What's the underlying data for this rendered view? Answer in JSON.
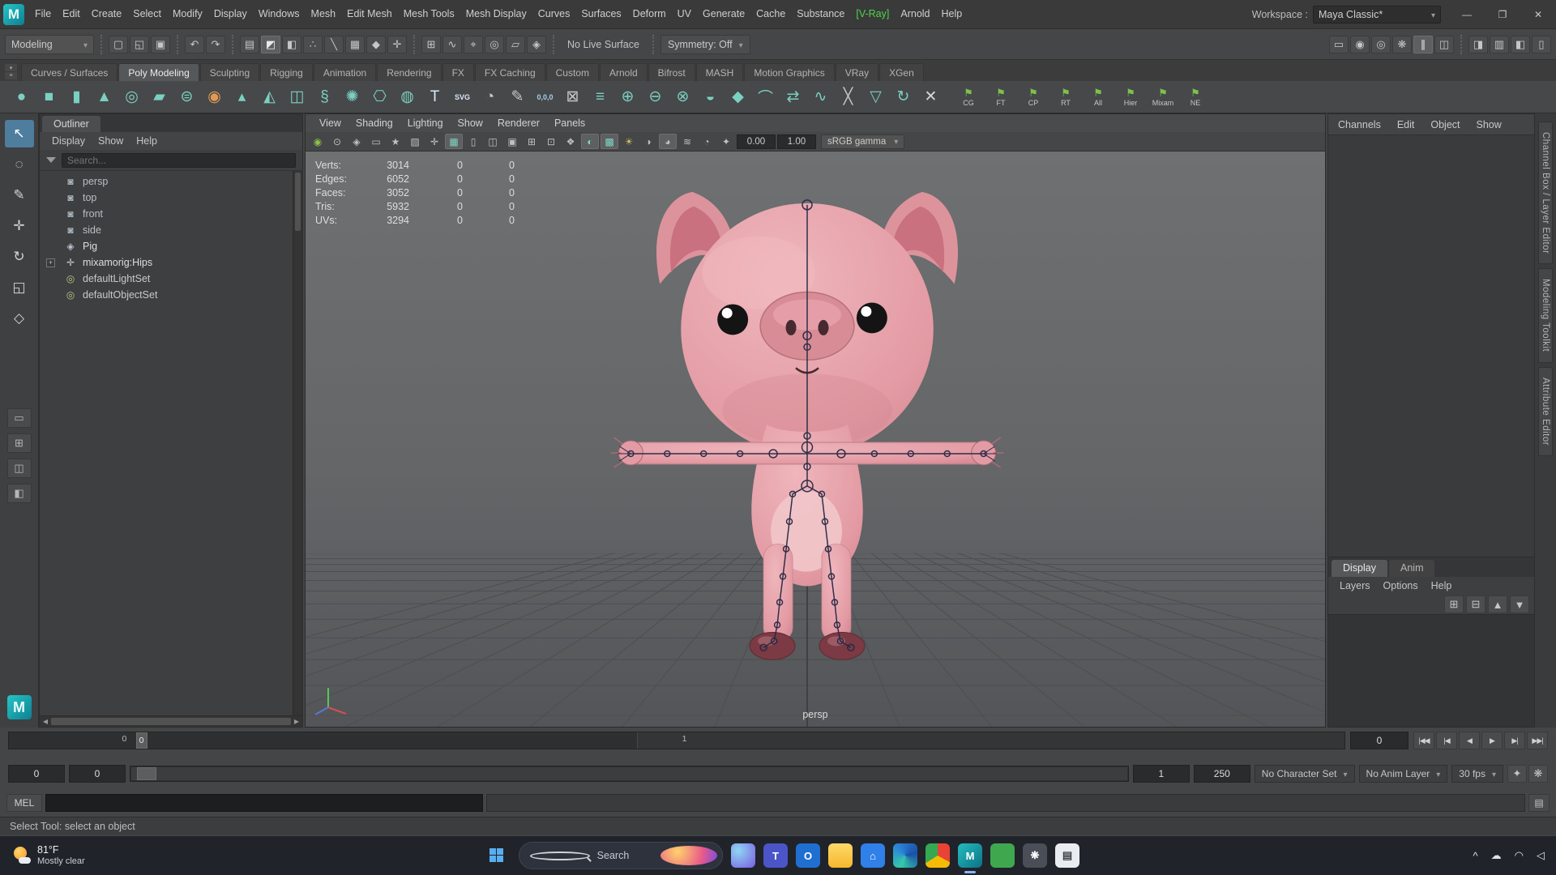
{
  "titlebar": {
    "menus": [
      {
        "label": "File"
      },
      {
        "label": "Edit"
      },
      {
        "label": "Create"
      },
      {
        "label": "Select"
      },
      {
        "label": "Modify"
      },
      {
        "label": "Display"
      },
      {
        "label": "Windows"
      },
      {
        "label": "Mesh"
      },
      {
        "label": "Edit Mesh"
      },
      {
        "label": "Mesh Tools"
      },
      {
        "label": "Mesh Display"
      },
      {
        "label": "Curves"
      },
      {
        "label": "Surfaces"
      },
      {
        "label": "Deform"
      },
      {
        "label": "UV"
      },
      {
        "label": "Generate"
      },
      {
        "label": "Cache"
      },
      {
        "label": "Substance"
      },
      {
        "label": "[V-Ray]",
        "color": "#4ed44e"
      },
      {
        "label": "Arnold"
      },
      {
        "label": "Help"
      }
    ],
    "workspace_label": "Workspace :",
    "workspace_value": "Maya Classic*"
  },
  "window_controls": {
    "minimize": "—",
    "maximize": "❐",
    "close": "✕"
  },
  "statusline": {
    "mode": "Modeling",
    "file_icons": [
      {
        "name": "new-scene-icon",
        "glyph": "▢"
      },
      {
        "name": "open-scene-icon",
        "glyph": "◱"
      },
      {
        "name": "save-scene-icon",
        "glyph": "▣"
      }
    ],
    "undo_icons": [
      {
        "name": "undo-icon",
        "glyph": "↶"
      },
      {
        "name": "redo-icon",
        "glyph": "↷"
      }
    ],
    "selection_icons": [
      {
        "name": "select-hierarchy-icon",
        "glyph": "▤"
      },
      {
        "name": "select-object-icon",
        "glyph": "◩",
        "active": true
      },
      {
        "name": "select-component-icon",
        "glyph": "◧"
      },
      {
        "name": "select-mask-points-icon",
        "glyph": "∴"
      },
      {
        "name": "select-mask-lines-icon",
        "glyph": "╲"
      },
      {
        "name": "select-mask-faces-icon",
        "glyph": "▦"
      },
      {
        "name": "select-mask-hulls-icon",
        "glyph": "◆"
      },
      {
        "name": "select-mask-rendering-icon",
        "glyph": "✛"
      }
    ],
    "snap_icons": [
      {
        "name": "snap-grid-icon",
        "glyph": "⊞"
      },
      {
        "name": "snap-curve-icon",
        "glyph": "∿"
      },
      {
        "name": "snap-point-icon",
        "glyph": "⌖"
      },
      {
        "name": "snap-projected-center-icon",
        "glyph": "◎"
      },
      {
        "name": "snap-view-plane-icon",
        "glyph": "▱"
      },
      {
        "name": "make-object-live-icon",
        "glyph": "◈"
      }
    ],
    "live_surface_label": "No Live Surface",
    "symmetry_label": "Symmetry: Off",
    "render_icons": [
      {
        "name": "render-view-icon",
        "glyph": "▭"
      },
      {
        "name": "render-current-frame-icon",
        "glyph": "◉"
      },
      {
        "name": "ipr-render-icon",
        "glyph": "◎"
      },
      {
        "name": "render-settings-icon",
        "glyph": "❋"
      },
      {
        "name": "pause-viewport-icon",
        "glyph": "∥",
        "active": true
      },
      {
        "name": "layout-toggle-icon",
        "glyph": "◫"
      }
    ],
    "panel_toggle_icons": [
      {
        "name": "toggle-attribute-editor-icon",
        "glyph": "◨"
      },
      {
        "name": "toggle-tool-settings-icon",
        "glyph": "▥"
      },
      {
        "name": "toggle-channel-box-icon",
        "glyph": "◧"
      },
      {
        "name": "toggle-outliner-icon",
        "glyph": "▯"
      }
    ]
  },
  "shelf": {
    "tabs": [
      {
        "label": "Curves / Surfaces"
      },
      {
        "label": "Poly Modeling",
        "active": true
      },
      {
        "label": "Sculpting"
      },
      {
        "label": "Rigging"
      },
      {
        "label": "Animation"
      },
      {
        "label": "Rendering"
      },
      {
        "label": "FX"
      },
      {
        "label": "FX Caching"
      },
      {
        "label": "Custom"
      },
      {
        "label": "Arnold"
      },
      {
        "label": "Bifrost"
      },
      {
        "label": "MASH"
      },
      {
        "label": "Motion Graphics"
      },
      {
        "label": "VRay"
      },
      {
        "label": "XGen"
      }
    ],
    "icons": [
      {
        "name": "poly-sphere-icon",
        "glyph": "●",
        "color": "#7ad0c2"
      },
      {
        "name": "poly-cube-icon",
        "glyph": "■",
        "color": "#7ad0c2"
      },
      {
        "name": "poly-cylinder-icon",
        "glyph": "▮",
        "color": "#7ad0c2"
      },
      {
        "name": "poly-cone-icon",
        "glyph": "▲",
        "color": "#7ad0c2"
      },
      {
        "name": "poly-torus-icon",
        "glyph": "◎",
        "color": "#7ad0c2"
      },
      {
        "name": "poly-plane-icon",
        "glyph": "▰",
        "color": "#7ad0c2"
      },
      {
        "name": "poly-disc-icon",
        "glyph": "⊜",
        "color": "#7ad0c2"
      },
      {
        "name": "platonic-solid-icon",
        "glyph": "◉",
        "color": "#e09a55"
      },
      {
        "name": "poly-pyramid-icon",
        "glyph": "▴",
        "color": "#7ad0c2"
      },
      {
        "name": "poly-prism-icon",
        "glyph": "◭",
        "color": "#7ad0c2"
      },
      {
        "name": "poly-pipe-icon",
        "glyph": "◫",
        "color": "#7ad0c2"
      },
      {
        "name": "poly-helix-icon",
        "glyph": "§",
        "color": "#7ad0c2"
      },
      {
        "name": "poly-gear-icon",
        "glyph": "✺",
        "color": "#7ad0c2"
      },
      {
        "name": "poly-soccer-ball-icon",
        "glyph": "⎔",
        "color": "#7ad0c2"
      },
      {
        "name": "super-ellipse-icon",
        "glyph": "◍",
        "color": "#7ad0c2"
      },
      {
        "name": "type-tool-icon",
        "glyph": "T",
        "color": "#d8e8f8"
      },
      {
        "name": "svg-tool-icon",
        "glyph": "SVG",
        "color": "#d8e8f8",
        "small": true
      },
      {
        "name": "sculpt-tool-icon",
        "glyph": "◔",
        "color": "#c8c8c8"
      },
      {
        "name": "quad-draw-icon",
        "glyph": "✎",
        "color": "#c8c8c8"
      },
      {
        "name": "coordinates-icon",
        "glyph": "0,0,0",
        "color": "#9fd0e8",
        "small": true
      },
      {
        "name": "multi-cut-icon",
        "glyph": "⊠",
        "color": "#c8c8c8"
      },
      {
        "name": "edge-flow-icon",
        "glyph": "≡",
        "color": "#7ad0c2"
      },
      {
        "name": "combine-icon",
        "glyph": "⊕",
        "color": "#7ad0c2"
      },
      {
        "name": "separate-icon",
        "glyph": "⊖",
        "color": "#7ad0c2"
      },
      {
        "name": "extract-icon",
        "glyph": "⊗",
        "color": "#7ad0c2"
      },
      {
        "name": "boolean-icon",
        "glyph": "◒",
        "color": "#7ad0c2"
      },
      {
        "name": "bevel-icon",
        "glyph": "◆",
        "color": "#7ad0c2"
      },
      {
        "name": "bridge-icon",
        "glyph": "⌒",
        "color": "#7ad0c2"
      },
      {
        "name": "mirror-icon",
        "glyph": "⇄",
        "color": "#7ad0c2"
      },
      {
        "name": "smooth-icon",
        "glyph": "∿",
        "color": "#7ad0c2"
      },
      {
        "name": "crease-icon",
        "glyph": "╳",
        "color": "#c8c8c8"
      },
      {
        "name": "reduce-icon",
        "glyph": "▽",
        "color": "#7ad0c2"
      },
      {
        "name": "spin-edge-icon",
        "glyph": "↻",
        "color": "#7ad0c2"
      },
      {
        "name": "delete-history-icon",
        "glyph": "✕",
        "color": "#d6d6d6"
      }
    ],
    "labeled_buttons": [
      {
        "name": "shelf-cg-button",
        "glyph": "⚑",
        "label": "CG"
      },
      {
        "name": "shelf-ft-button",
        "glyph": "⚑",
        "label": "FT"
      },
      {
        "name": "shelf-cp-button",
        "glyph": "⚑",
        "label": "CP"
      },
      {
        "name": "shelf-rt-button",
        "glyph": "⚑",
        "label": "RT"
      },
      {
        "name": "shelf-all-button",
        "glyph": "⚑",
        "label": "All"
      },
      {
        "name": "shelf-hier-button",
        "glyph": "⚑",
        "label": "Hier"
      },
      {
        "name": "shelf-mixamo-button",
        "glyph": "⚑",
        "label": "Mixam"
      },
      {
        "name": "shelf-ne-button",
        "glyph": "⚑",
        "label": "NE"
      }
    ]
  },
  "toolbox": {
    "tools": [
      {
        "name": "select-tool",
        "glyph": "↖",
        "active": true
      },
      {
        "name": "lasso-tool",
        "glyph": "◌"
      },
      {
        "name": "paint-select-tool",
        "glyph": "✎"
      },
      {
        "name": "move-tool",
        "glyph": "✛"
      },
      {
        "name": "rotate-tool",
        "glyph": "↻"
      },
      {
        "name": "scale-tool",
        "glyph": "◱"
      },
      {
        "name": "last-tool-slot",
        "glyph": "◇"
      }
    ],
    "layouts": [
      {
        "name": "layout-single-pane",
        "glyph": "▭"
      },
      {
        "name": "layout-four-pane",
        "glyph": "⊞"
      },
      {
        "name": "layout-two-pane",
        "glyph": "◫"
      },
      {
        "name": "layout-outliner-persp",
        "glyph": "◧"
      }
    ]
  },
  "outliner": {
    "panel_title": "Outliner",
    "menus": [
      {
        "label": "Display"
      },
      {
        "label": "Show"
      },
      {
        "label": "Help"
      }
    ],
    "search_placeholder": "Search...",
    "items": [
      {
        "label": "persp",
        "icon_name": "camera-icon",
        "glyph": "◙",
        "glyph_color": "#a8b4bd",
        "label_color": "#b9bec4"
      },
      {
        "label": "top",
        "icon_name": "camera-icon",
        "glyph": "◙",
        "glyph_color": "#a8b4bd",
        "label_color": "#b9bec4"
      },
      {
        "label": "front",
        "icon_name": "camera-icon",
        "glyph": "◙",
        "glyph_color": "#a8b4bd",
        "label_color": "#b9bec4"
      },
      {
        "label": "side",
        "icon_name": "camera-icon",
        "glyph": "◙",
        "glyph_color": "#a8b4bd",
        "label_color": "#b9bec4"
      },
      {
        "label": "Pig",
        "icon_name": "mesh-icon",
        "glyph": "◈",
        "glyph_color": "#b9c4d0",
        "label_color": "#dedede"
      },
      {
        "label": "mixamorig:Hips",
        "icon_name": "joint-icon",
        "glyph": "✛",
        "glyph_color": "#c8c8c8",
        "label_color": "#dedede",
        "expandable": true
      },
      {
        "label": "defaultLightSet",
        "icon_name": "set-icon",
        "glyph": "◎",
        "glyph_color": "#c2c28a",
        "label_color": "#c9c9c9"
      },
      {
        "label": "defaultObjectSet",
        "icon_name": "set-icon",
        "glyph": "◎",
        "glyph_color": "#c2c28a",
        "label_color": "#c9c9c9"
      }
    ]
  },
  "viewport": {
    "menus": [
      {
        "label": "View"
      },
      {
        "label": "Shading"
      },
      {
        "label": "Lighting"
      },
      {
        "label": "Show"
      },
      {
        "label": "Renderer"
      },
      {
        "label": "Panels"
      }
    ],
    "toolbar_icons": [
      {
        "name": "renderer-status-icon",
        "glyph": "◉",
        "color": "#8cc04a"
      },
      {
        "name": "select-camera-icon",
        "glyph": "⊙",
        "color": "#c0c0c0"
      },
      {
        "name": "lock-camera-icon",
        "glyph": "◈",
        "color": "#c0c0c0"
      },
      {
        "name": "camera-attributes-icon",
        "glyph": "▭",
        "color": "#c0c0c0"
      },
      {
        "name": "bookmarks-icon",
        "glyph": "★",
        "color": "#c0c0c0"
      },
      {
        "name": "image-plane-icon",
        "glyph": "▨",
        "color": "#c0c0c0"
      },
      {
        "name": "pan-zoom-icon",
        "glyph": "✛",
        "color": "#c0c0c0"
      },
      {
        "name": "grid-toggle-icon",
        "glyph": "▦",
        "color": "#7fd4c4",
        "active": true
      },
      {
        "name": "film-gate-icon",
        "glyph": "▯",
        "color": "#c0c0c0"
      },
      {
        "name": "resolution-gate-icon",
        "glyph": "◫",
        "color": "#c0c0c0"
      },
      {
        "name": "gate-mask-icon",
        "glyph": "▣",
        "color": "#c0c0c0"
      },
      {
        "name": "field-chart-icon",
        "glyph": "⊞",
        "color": "#c0c0c0"
      },
      {
        "name": "safe-action-icon",
        "glyph": "⊡",
        "color": "#c0c0c0"
      },
      {
        "name": "wireframe-icon",
        "glyph": "❖",
        "color": "#c0c0c0"
      },
      {
        "name": "shaded-mode-icon",
        "glyph": "◐",
        "color": "#7fd4c4",
        "active": true
      },
      {
        "name": "textured-mode-icon",
        "glyph": "▩",
        "color": "#7fd4c4",
        "active": true
      },
      {
        "name": "lighting-icon",
        "glyph": "☀",
        "color": "#d8c468"
      },
      {
        "name": "shadows-icon",
        "glyph": "◑",
        "color": "#c0c0c0"
      },
      {
        "name": "screen-ao-icon",
        "glyph": "◕",
        "color": "#c0c0c0",
        "active": true
      },
      {
        "name": "motion-blur-icon",
        "glyph": "≋",
        "color": "#c0c0c0"
      },
      {
        "name": "xray-icon",
        "glyph": "◔",
        "color": "#c0c0c0"
      },
      {
        "name": "isolate-select-icon",
        "glyph": "✦",
        "color": "#c0c0c0"
      }
    ],
    "exposure": "0.00",
    "gamma": "1.00",
    "colorspace": "sRGB gamma",
    "hud": {
      "rows": [
        {
          "label": "Verts:",
          "value": "3014",
          "col1": "0",
          "col2": "0"
        },
        {
          "label": "Edges:",
          "value": "6052",
          "col1": "0",
          "col2": "0"
        },
        {
          "label": "Faces:",
          "value": "3052",
          "col1": "0",
          "col2": "0"
        },
        {
          "label": "Tris:",
          "value": "5932",
          "col1": "0",
          "col2": "0"
        },
        {
          "label": "UVs:",
          "value": "3294",
          "col1": "0",
          "col2": "0"
        }
      ]
    },
    "camera_label": "persp"
  },
  "channel_box": {
    "menus": [
      {
        "label": "Channels"
      },
      {
        "label": "Edit"
      },
      {
        "label": "Object"
      },
      {
        "label": "Show"
      }
    ]
  },
  "side_tabs": [
    {
      "label": "Channel Box / Layer Editor"
    },
    {
      "label": "Modeling Toolkit"
    },
    {
      "label": "Attribute Editor"
    }
  ],
  "layer_editor": {
    "tabs": [
      {
        "label": "Display",
        "active": true
      },
      {
        "label": "Anim"
      }
    ],
    "menus": [
      {
        "label": "Layers"
      },
      {
        "label": "Options"
      },
      {
        "label": "Help"
      }
    ],
    "icons": [
      {
        "name": "empty-layer-icon",
        "glyph": "⊞"
      },
      {
        "name": "layer-from-selected-icon",
        "glyph": "⊟"
      },
      {
        "name": "move-layer-up-icon",
        "glyph": "▲"
      },
      {
        "name": "move-layer-down-icon",
        "glyph": "▼"
      }
    ]
  },
  "timeslider": {
    "tick_start": "0",
    "tick_mid": "1",
    "current_frame": "0",
    "frame_field": "0",
    "playback": [
      {
        "name": "go-to-start-button",
        "glyph": "|◀◀"
      },
      {
        "name": "step-back-key-button",
        "glyph": "|◀"
      },
      {
        "name": "step-back-frame-button",
        "glyph": "◀"
      },
      {
        "name": "play-forward-button",
        "glyph": "▶"
      },
      {
        "name": "step-forward-key-button",
        "glyph": "▶|"
      },
      {
        "name": "go-to-end-button",
        "glyph": "▶▶|"
      }
    ]
  },
  "rangeslider": {
    "anim_start": "0",
    "playback_start": "0",
    "playback_end": "1",
    "anim_end": "250",
    "character_set": "No Character Set",
    "anim_layer": "No Anim Layer",
    "fps": "30 fps",
    "icons": [
      {
        "name": "auto-key-icon",
        "glyph": "✦"
      },
      {
        "name": "anim-preferences-icon",
        "glyph": "❋"
      }
    ]
  },
  "command_line": {
    "label": "MEL"
  },
  "help_line": {
    "text": "Select Tool: select an object"
  },
  "taskbar": {
    "weather_temp": "81°F",
    "weather_condition": "Mostly clear",
    "search_label": "Search",
    "apps": [
      {
        "name": "copilot-app-icon",
        "bg": "radial-gradient(circle at 30% 30%, #8fd6f5, #7a5de0)",
        "round": true
      },
      {
        "name": "teams-app-icon",
        "bg": "#4b55c8",
        "glyph": "T"
      },
      {
        "name": "outlook-app-icon",
        "bg": "#1f6fd0",
        "glyph": "O"
      },
      {
        "name": "explorer-app-icon",
        "bg": "linear-gradient(180deg,#ffd96a,#f5b82e)"
      },
      {
        "name": "store-app-icon",
        "bg": "#2f80e8",
        "glyph": "⌂"
      },
      {
        "name": "edge-app-icon",
        "bg": "conic-gradient(from 200deg,#35c8a8,#2a84d8,#1a50a8,#35c8a8)",
        "round": true
      },
      {
        "name": "chrome-app-icon",
        "bg": "conic-gradient(#e84335 0 33%,#f5bc05 33% 66%,#34a853 66% 100%)",
        "round": true
      },
      {
        "name": "maya-app-icon",
        "bg": "linear-gradient(135deg,#23bdbd,#0c7186)",
        "glyph": "M",
        "active": true
      },
      {
        "name": "octane-app-icon",
        "bg": "#3fa84e",
        "round": true
      },
      {
        "name": "settings-app-icon",
        "bg": "#4a4e56",
        "glyph": "❋"
      },
      {
        "name": "notepad-app-icon",
        "bg": "#e9edf2",
        "glyph": "▤",
        "glyph_color": "#3a3f46"
      }
    ],
    "tray": [
      {
        "name": "hidden-icons-icon",
        "glyph": "^"
      },
      {
        "name": "onedrive-icon",
        "glyph": "☁"
      },
      {
        "name": "wifi-icon",
        "glyph": "◠"
      },
      {
        "name": "volume-icon",
        "glyph": "◁"
      }
    ]
  }
}
